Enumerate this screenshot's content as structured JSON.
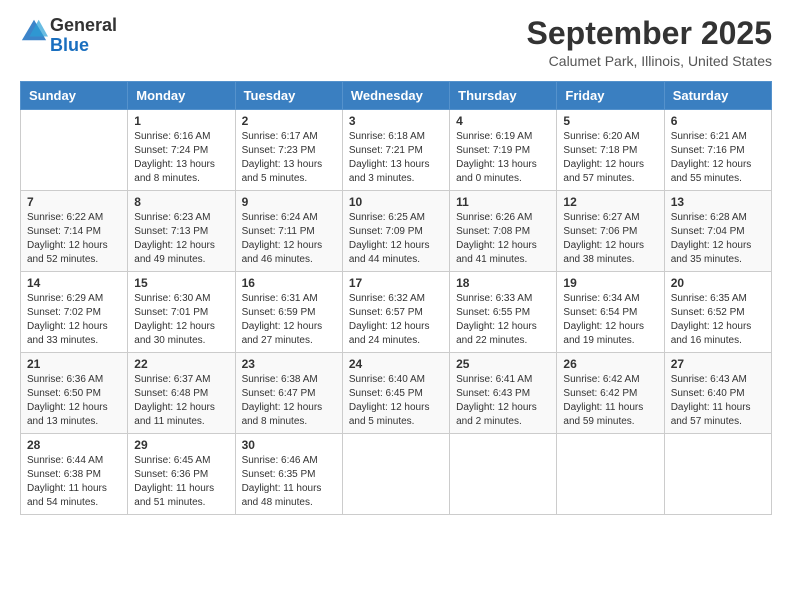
{
  "logo": {
    "general": "General",
    "blue": "Blue"
  },
  "header": {
    "month": "September 2025",
    "location": "Calumet Park, Illinois, United States"
  },
  "weekdays": [
    "Sunday",
    "Monday",
    "Tuesday",
    "Wednesday",
    "Thursday",
    "Friday",
    "Saturday"
  ],
  "weeks": [
    [
      null,
      {
        "day": 1,
        "sunrise": "6:16 AM",
        "sunset": "7:24 PM",
        "daylight": "13 hours and 8 minutes."
      },
      {
        "day": 2,
        "sunrise": "6:17 AM",
        "sunset": "7:23 PM",
        "daylight": "13 hours and 5 minutes."
      },
      {
        "day": 3,
        "sunrise": "6:18 AM",
        "sunset": "7:21 PM",
        "daylight": "13 hours and 3 minutes."
      },
      {
        "day": 4,
        "sunrise": "6:19 AM",
        "sunset": "7:19 PM",
        "daylight": "13 hours and 0 minutes."
      },
      {
        "day": 5,
        "sunrise": "6:20 AM",
        "sunset": "7:18 PM",
        "daylight": "12 hours and 57 minutes."
      },
      {
        "day": 6,
        "sunrise": "6:21 AM",
        "sunset": "7:16 PM",
        "daylight": "12 hours and 55 minutes."
      }
    ],
    [
      {
        "day": 7,
        "sunrise": "6:22 AM",
        "sunset": "7:14 PM",
        "daylight": "12 hours and 52 minutes."
      },
      {
        "day": 8,
        "sunrise": "6:23 AM",
        "sunset": "7:13 PM",
        "daylight": "12 hours and 49 minutes."
      },
      {
        "day": 9,
        "sunrise": "6:24 AM",
        "sunset": "7:11 PM",
        "daylight": "12 hours and 46 minutes."
      },
      {
        "day": 10,
        "sunrise": "6:25 AM",
        "sunset": "7:09 PM",
        "daylight": "12 hours and 44 minutes."
      },
      {
        "day": 11,
        "sunrise": "6:26 AM",
        "sunset": "7:08 PM",
        "daylight": "12 hours and 41 minutes."
      },
      {
        "day": 12,
        "sunrise": "6:27 AM",
        "sunset": "7:06 PM",
        "daylight": "12 hours and 38 minutes."
      },
      {
        "day": 13,
        "sunrise": "6:28 AM",
        "sunset": "7:04 PM",
        "daylight": "12 hours and 35 minutes."
      }
    ],
    [
      {
        "day": 14,
        "sunrise": "6:29 AM",
        "sunset": "7:02 PM",
        "daylight": "12 hours and 33 minutes."
      },
      {
        "day": 15,
        "sunrise": "6:30 AM",
        "sunset": "7:01 PM",
        "daylight": "12 hours and 30 minutes."
      },
      {
        "day": 16,
        "sunrise": "6:31 AM",
        "sunset": "6:59 PM",
        "daylight": "12 hours and 27 minutes."
      },
      {
        "day": 17,
        "sunrise": "6:32 AM",
        "sunset": "6:57 PM",
        "daylight": "12 hours and 24 minutes."
      },
      {
        "day": 18,
        "sunrise": "6:33 AM",
        "sunset": "6:55 PM",
        "daylight": "12 hours and 22 minutes."
      },
      {
        "day": 19,
        "sunrise": "6:34 AM",
        "sunset": "6:54 PM",
        "daylight": "12 hours and 19 minutes."
      },
      {
        "day": 20,
        "sunrise": "6:35 AM",
        "sunset": "6:52 PM",
        "daylight": "12 hours and 16 minutes."
      }
    ],
    [
      {
        "day": 21,
        "sunrise": "6:36 AM",
        "sunset": "6:50 PM",
        "daylight": "12 hours and 13 minutes."
      },
      {
        "day": 22,
        "sunrise": "6:37 AM",
        "sunset": "6:48 PM",
        "daylight": "12 hours and 11 minutes."
      },
      {
        "day": 23,
        "sunrise": "6:38 AM",
        "sunset": "6:47 PM",
        "daylight": "12 hours and 8 minutes."
      },
      {
        "day": 24,
        "sunrise": "6:40 AM",
        "sunset": "6:45 PM",
        "daylight": "12 hours and 5 minutes."
      },
      {
        "day": 25,
        "sunrise": "6:41 AM",
        "sunset": "6:43 PM",
        "daylight": "12 hours and 2 minutes."
      },
      {
        "day": 26,
        "sunrise": "6:42 AM",
        "sunset": "6:42 PM",
        "daylight": "11 hours and 59 minutes."
      },
      {
        "day": 27,
        "sunrise": "6:43 AM",
        "sunset": "6:40 PM",
        "daylight": "11 hours and 57 minutes."
      }
    ],
    [
      {
        "day": 28,
        "sunrise": "6:44 AM",
        "sunset": "6:38 PM",
        "daylight": "11 hours and 54 minutes."
      },
      {
        "day": 29,
        "sunrise": "6:45 AM",
        "sunset": "6:36 PM",
        "daylight": "11 hours and 51 minutes."
      },
      {
        "day": 30,
        "sunrise": "6:46 AM",
        "sunset": "6:35 PM",
        "daylight": "11 hours and 48 minutes."
      },
      null,
      null,
      null,
      null
    ]
  ],
  "labels": {
    "sunrise": "Sunrise:",
    "sunset": "Sunset:",
    "daylight": "Daylight:"
  }
}
